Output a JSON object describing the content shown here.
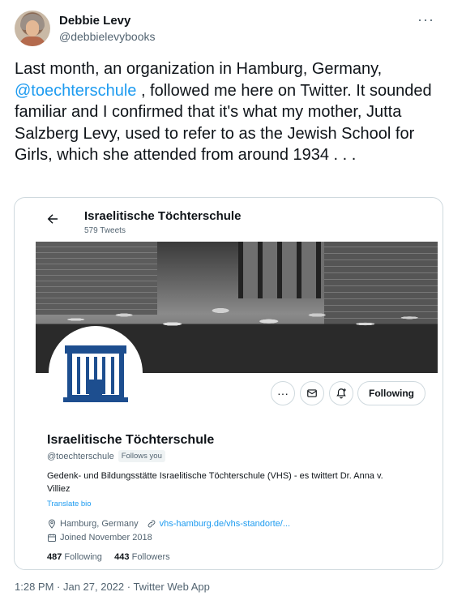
{
  "author": {
    "display_name": "Debbie Levy",
    "handle": "@debbielevybooks"
  },
  "tweet": {
    "text_before": "Last month, an organization in Hamburg, Germany, ",
    "mention": "@toechterschule",
    "text_after": " , followed me here on Twitter. It sounded familiar and I confirmed that it's what my mother, Jutta Salzberg Levy, used to refer to as the Jewish School for Girls, which she attended from around 1934 . . .",
    "timestamp": "1:28 PM · Jan 27, 2022 · Twitter Web App"
  },
  "profile_card": {
    "top_title": "Israelitische Töchterschule",
    "top_tweets": "579 Tweets",
    "name": "Israelitische Töchterschule",
    "handle": "@toechterschule",
    "follows_you": "Follows you",
    "bio": "Gedenk- und Bildungsstätte Israelitische Töchterschule (VHS) - es twittert Dr. Anna v. Villiez",
    "translate": "Translate bio",
    "location": "Hamburg, Germany",
    "website": "vhs-hamburg.de/vhs-standorte/...",
    "joined": "Joined November 2018",
    "following_count": "487",
    "following_label": "Following",
    "followers_count": "443",
    "followers_label": "Followers",
    "follow_button": "Following",
    "more_button": "···"
  },
  "icons": {
    "more": "more-horizontal-icon",
    "back": "arrow-left-icon",
    "message": "envelope-icon",
    "notify": "bell-plus-icon",
    "location": "map-pin-icon",
    "link": "link-icon",
    "calendar": "calendar-icon"
  },
  "colors": {
    "accent": "#1d9bf0",
    "text": "#0f1419",
    "muted": "#536471",
    "border": "#cfd9de",
    "logo_blue": "#1d4e8f"
  }
}
